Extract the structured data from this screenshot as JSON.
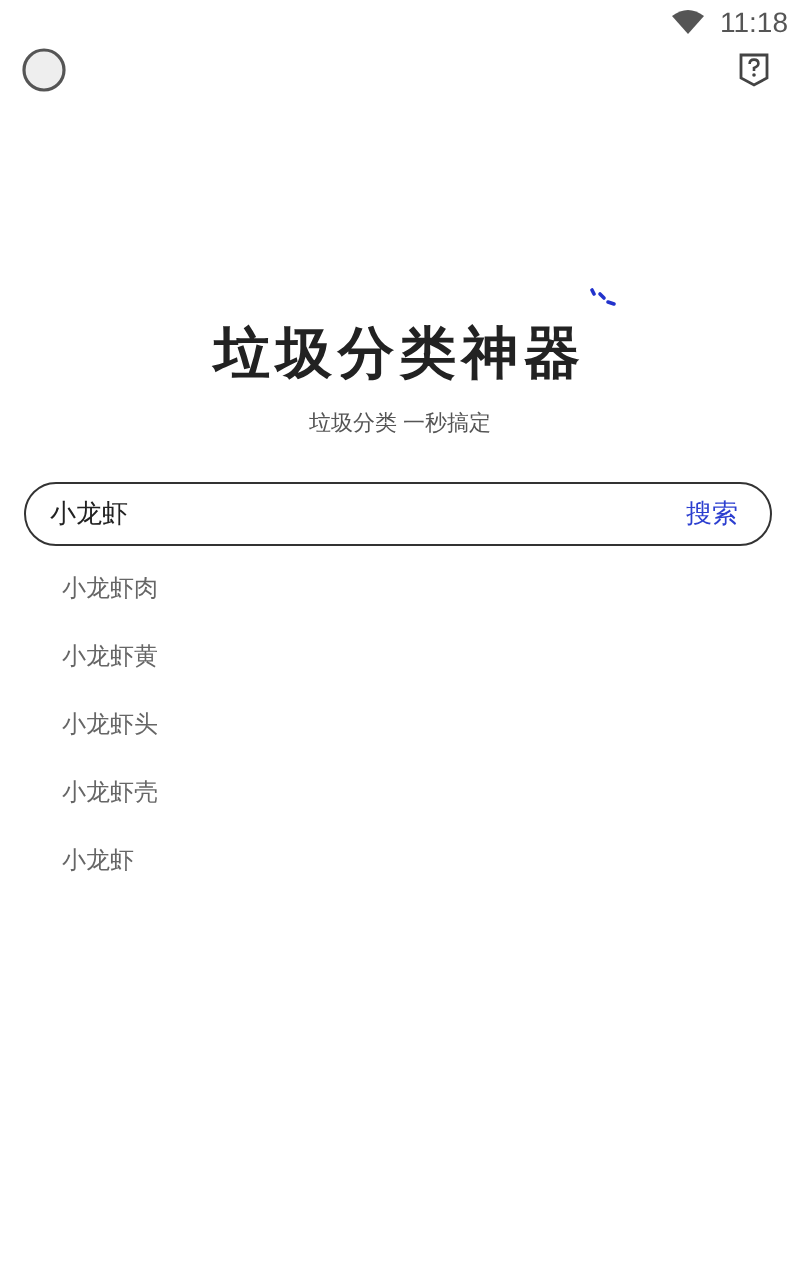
{
  "status_bar": {
    "time": "11:18"
  },
  "title": "垃圾分类神器",
  "subtitle": "垃圾分类 一秒搞定",
  "search": {
    "value": "小龙虾",
    "button": "搜索"
  },
  "suggestions": [
    "小龙虾肉",
    "小龙虾黄",
    "小龙虾头",
    "小龙虾壳",
    "小龙虾"
  ]
}
